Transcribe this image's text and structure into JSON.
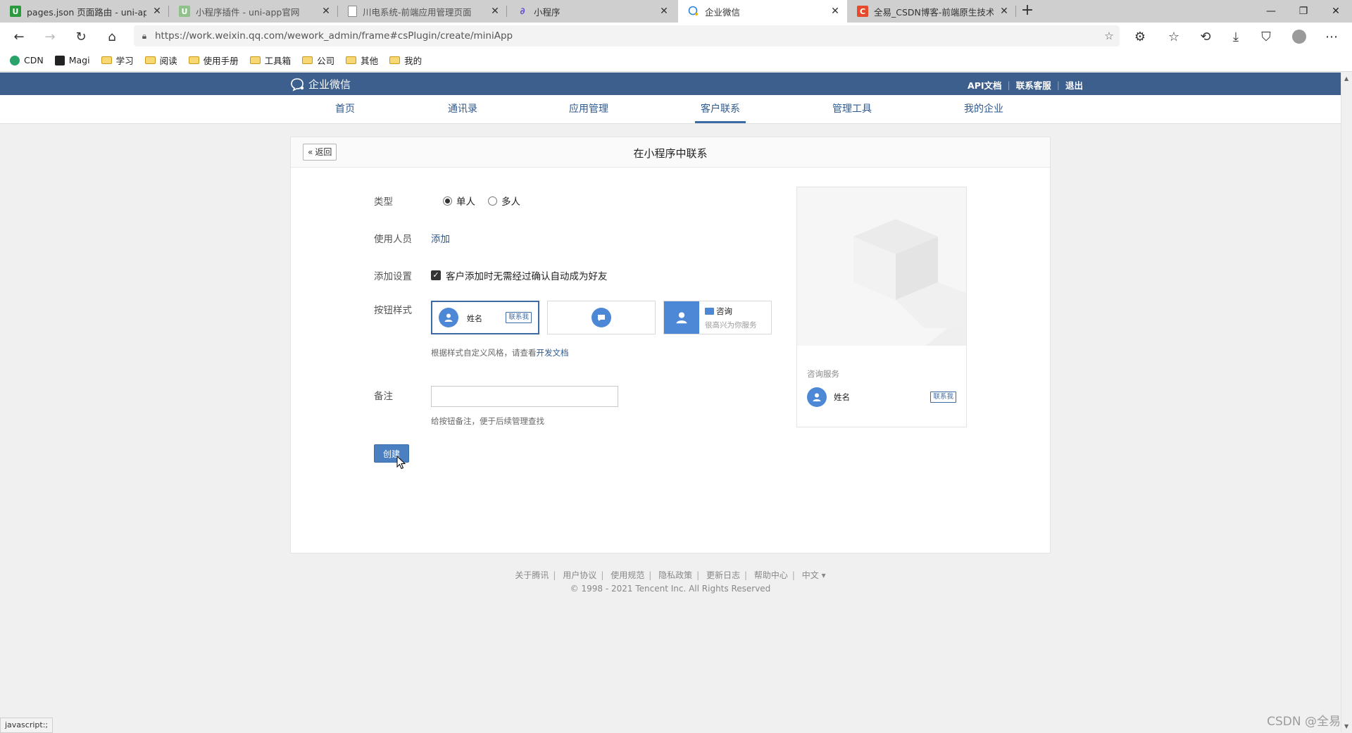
{
  "browser": {
    "tabs": [
      {
        "title": "pages.json 页面路由 - uni-app官",
        "favicon": "uni-green",
        "active": false
      },
      {
        "title": "小程序插件 - uni-app官网",
        "favicon": "uni-lightgreen",
        "active": false
      },
      {
        "title": "川电系统-前端应用管理页面",
        "favicon": "page",
        "active": false
      },
      {
        "title": "小程序",
        "favicon": "link",
        "active": false
      },
      {
        "title": "企业微信",
        "favicon": "wework",
        "active": true
      },
      {
        "title": "全易_CSDN博客-前端原生技术:",
        "favicon": "csdn",
        "active": false
      }
    ],
    "url": "https://work.weixin.qq.com/wework_admin/frame#csPlugin/create/miniApp",
    "bookmarks": [
      {
        "label": "CDN",
        "icon": "cdn-icon"
      },
      {
        "label": "Magi",
        "icon": "magi-icon"
      },
      {
        "label": "学习",
        "icon": "folder-icon"
      },
      {
        "label": "阅读",
        "icon": "folder-icon"
      },
      {
        "label": "使用手册",
        "icon": "folder-icon"
      },
      {
        "label": "工具箱",
        "icon": "folder-icon"
      },
      {
        "label": "公司",
        "icon": "folder-icon"
      },
      {
        "label": "其他",
        "icon": "folder-icon"
      },
      {
        "label": "我的",
        "icon": "folder-icon"
      }
    ]
  },
  "header": {
    "logo_text": "企业微信",
    "links": [
      "API文档",
      "联系客服",
      "退出"
    ],
    "nav": [
      "首页",
      "通讯录",
      "应用管理",
      "客户联系",
      "管理工具",
      "我的企业"
    ],
    "active_nav": "客户联系"
  },
  "card": {
    "back_label": "返回",
    "title": "在小程序中联系",
    "type_label": "类型",
    "type_options": [
      "单人",
      "多人"
    ],
    "type_selected": "单人",
    "users_label": "使用人员",
    "users_add": "添加",
    "add_settings_label": "添加设置",
    "add_settings_checkbox": "客户添加时无需经过确认自动成为好友",
    "add_settings_checked": true,
    "button_style_label": "按钮样式",
    "style1_name": "姓名",
    "style1_badge": "联系我",
    "style3_title": "咨询",
    "style3_sub": "很高兴为你服务",
    "style_hint_prefix": "根据样式自定义风格，请查看",
    "style_hint_link": "开发文档",
    "remark_label": "备注",
    "remark_value": "",
    "remark_hint": "给按钮备注，便于后续管理查找",
    "create_label": "创建"
  },
  "preview": {
    "section_label": "咨询服务",
    "name": "姓名",
    "badge": "联系我"
  },
  "footer": {
    "links": [
      "关于腾讯",
      "用户协议",
      "使用规范",
      "隐私政策",
      "更新日志",
      "帮助中心",
      "中文 ▾"
    ],
    "copyright": "© 1998 - 2021 Tencent Inc. All Rights Reserved"
  },
  "statusbar": "javascript:;",
  "watermark": "CSDN @全易",
  "colors": {
    "header_bg": "#3d5f8d",
    "link": "#2f5a8f",
    "primary": "#4a7fc1",
    "avatar": "#4d88d6"
  }
}
